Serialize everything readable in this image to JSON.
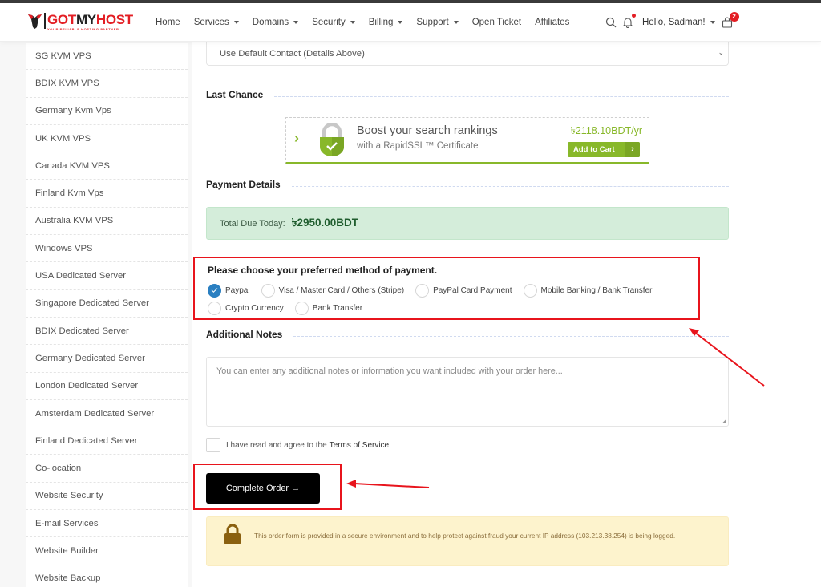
{
  "brand": {
    "logo_text_red1": "GOT",
    "logo_text_dark": "MY",
    "logo_text_red2": "HOST",
    "tagline": "YOUR RELIABLE HOSTING PARTNER",
    "color_primary": "#e31e24"
  },
  "nav": {
    "items": [
      {
        "label": "Home",
        "dropdown": false
      },
      {
        "label": "Services",
        "dropdown": true
      },
      {
        "label": "Domains",
        "dropdown": true
      },
      {
        "label": "Security",
        "dropdown": true
      },
      {
        "label": "Billing",
        "dropdown": true
      },
      {
        "label": "Support",
        "dropdown": true
      },
      {
        "label": "Open Ticket",
        "dropdown": false
      },
      {
        "label": "Affiliates",
        "dropdown": false
      }
    ],
    "greeting": "Hello, Sadman!",
    "cart_count": "2"
  },
  "sidebar": {
    "items": [
      "SG KVM VPS",
      "BDIX KVM VPS",
      "Germany Kvm Vps",
      "UK KVM VPS",
      "Canada KVM VPS",
      "Finland Kvm Vps",
      "Australia KVM VPS",
      "Windows VPS",
      "USA Dedicated Server",
      "Singapore Dedicated Server",
      "BDIX Dedicated Server",
      "Germany Dedicated Server",
      "London Dedicated Server",
      "Amsterdam Dedicated Server",
      "Finland Dedicated Server",
      "Co-location",
      "Website Security",
      "E-mail Services",
      "Website Builder",
      "Website Backup"
    ]
  },
  "checkout": {
    "contact_select": {
      "value": "Use Default Contact (Details Above)",
      "chevron": "⌄"
    },
    "last_chance": {
      "title": "Last Chance",
      "promo_headline": "Boost your search rankings",
      "promo_sub": "with a RapidSSL™ Certificate",
      "price": "৳2118.10BDT/yr",
      "add_to_cart": "Add to Cart",
      "accent_color": "#88b82a"
    },
    "payment_details": {
      "title": "Payment Details",
      "total_label": "Total Due Today:",
      "total_value": "৳2950.00BDT"
    },
    "payment_method": {
      "prompt": "Please choose your preferred method of payment.",
      "options": [
        {
          "label": "Paypal",
          "selected": true
        },
        {
          "label": "Visa / Master Card / Others (Stripe)",
          "selected": false
        },
        {
          "label": "PayPal Card Payment",
          "selected": false
        },
        {
          "label": "Mobile Banking / Bank Transfer",
          "selected": false
        },
        {
          "label": "Crypto Currency",
          "selected": false
        },
        {
          "label": "Bank Transfer",
          "selected": false
        }
      ]
    },
    "notes": {
      "title": "Additional Notes",
      "placeholder": "You can enter any additional notes or information you want included with your order here...",
      "value": ""
    },
    "tos": {
      "label": "I have read and agree to the",
      "link": "Terms of Service",
      "checked": false
    },
    "complete_button": "Complete Order →",
    "secure_notice": {
      "text": "This order form is provided in a secure environment and to help protect against fraud your current IP address (103.213.38.254) is being logged.",
      "ip": "103.213.38.254"
    }
  },
  "annotations": {
    "highlight_color": "#e8141c"
  }
}
